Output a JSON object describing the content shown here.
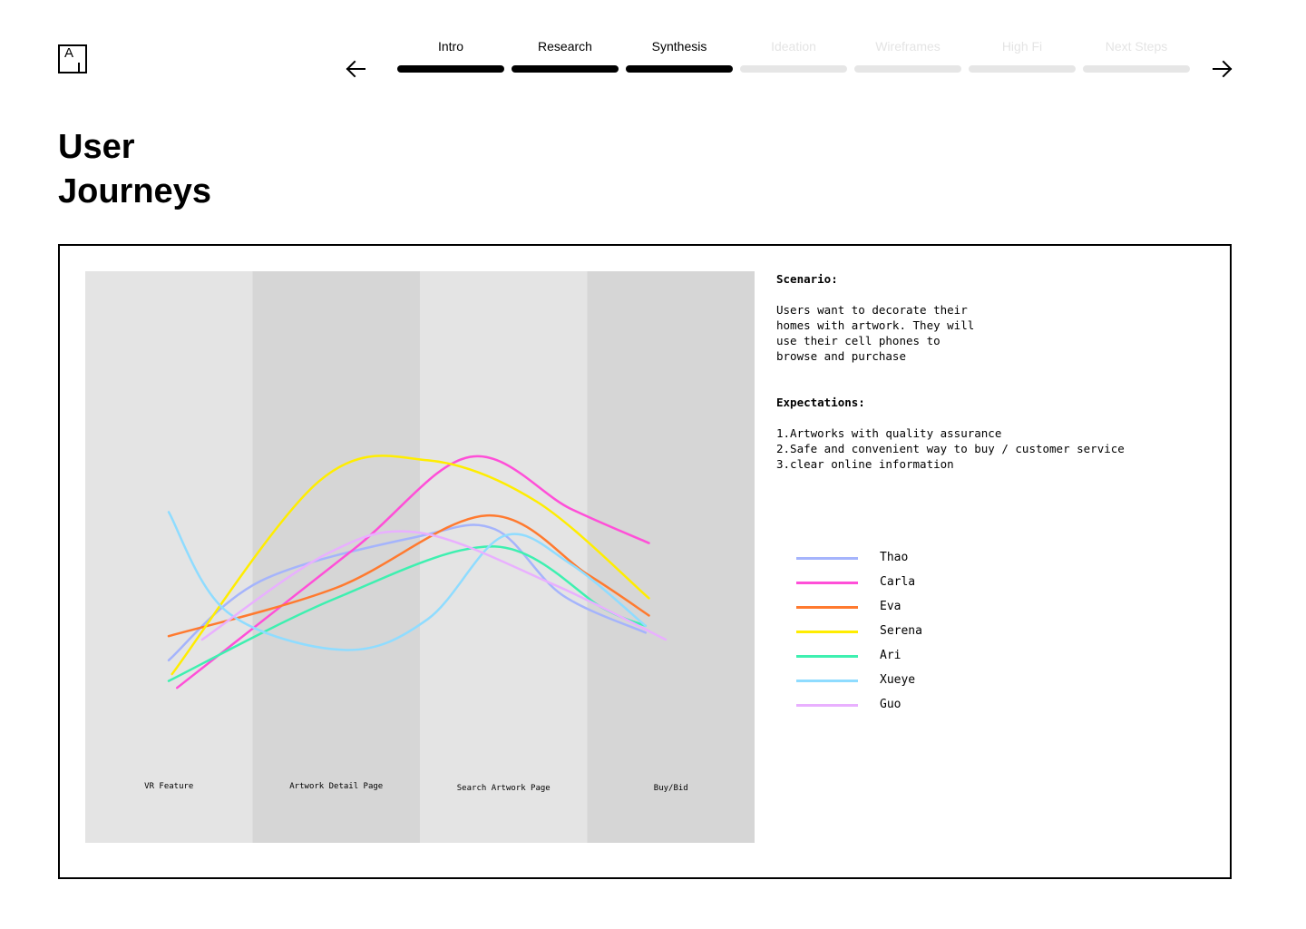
{
  "header": {
    "logo_letter": "A",
    "steps": [
      {
        "label": "Intro",
        "state": "done"
      },
      {
        "label": "Research",
        "state": "done"
      },
      {
        "label": "Synthesis",
        "state": "done"
      },
      {
        "label": "Ideation",
        "state": "todo"
      },
      {
        "label": "Wireframes",
        "state": "todo"
      },
      {
        "label": "High Fi",
        "state": "todo"
      },
      {
        "label": "Next Steps",
        "state": "todo"
      }
    ],
    "prev_icon": "arrow-left-icon",
    "next_icon": "arrow-right-icon"
  },
  "page": {
    "title_line1": "User",
    "title_line2": "Journeys"
  },
  "info": {
    "scenario_heading": "Scenario:",
    "scenario_text": "Users want to decorate their\nhomes with artwork. They will\nuse their cell phones to\nbrowse and purchase",
    "expectations_heading": "Expectations:",
    "expectations": [
      "1.Artworks with quality assurance",
      "2.Safe and convenient way to buy / customer service",
      "3.clear online information"
    ]
  },
  "chart_data": {
    "type": "line",
    "categories": [
      "VR Feature",
      "Artwork Detail Page",
      "Search Artwork Page",
      "Buy/Bid"
    ],
    "band_colors": [
      "#e4e4e4",
      "#d6d6d6",
      "#e4e4e4",
      "#d6d6d6"
    ],
    "y_range": [
      0,
      10
    ],
    "series": [
      {
        "name": "Thao",
        "color": "#a5b4fc",
        "points": [
          [
            0.0,
            2.4
          ],
          [
            0.55,
            4.7
          ],
          [
            1.5,
            6.0
          ],
          [
            1.95,
            6.2
          ],
          [
            2.35,
            4.3
          ],
          [
            2.85,
            3.2
          ]
        ]
      },
      {
        "name": "Carla",
        "color": "#ff4fd8",
        "points": [
          [
            0.05,
            1.6
          ],
          [
            1.1,
            5.6
          ],
          [
            1.8,
            8.3
          ],
          [
            2.4,
            6.8
          ],
          [
            2.87,
            5.8
          ]
        ]
      },
      {
        "name": "Eva",
        "color": "#ff7a2f",
        "points": [
          [
            0.0,
            3.1
          ],
          [
            1.0,
            4.5
          ],
          [
            1.9,
            6.6
          ],
          [
            2.5,
            4.9
          ],
          [
            2.87,
            3.7
          ]
        ]
      },
      {
        "name": "Serena",
        "color": "#ffed00",
        "points": [
          [
            0.02,
            2.0
          ],
          [
            0.9,
            7.6
          ],
          [
            1.55,
            8.2
          ],
          [
            2.2,
            7.0
          ],
          [
            2.87,
            4.2
          ]
        ]
      },
      {
        "name": "Ari",
        "color": "#3ef0b0",
        "points": [
          [
            0.0,
            1.8
          ],
          [
            1.0,
            4.2
          ],
          [
            1.95,
            5.7
          ],
          [
            2.6,
            3.9
          ],
          [
            2.85,
            3.4
          ]
        ]
      },
      {
        "name": "Xueye",
        "color": "#8fdcff",
        "points": [
          [
            0.0,
            6.7
          ],
          [
            0.35,
            3.8
          ],
          [
            1.05,
            2.7
          ],
          [
            1.55,
            3.6
          ],
          [
            2.0,
            6.0
          ],
          [
            2.4,
            5.2
          ],
          [
            2.85,
            3.4
          ]
        ]
      },
      {
        "name": "Guo",
        "color": "#e9b0ff",
        "points": [
          [
            0.2,
            3.0
          ],
          [
            0.95,
            5.5
          ],
          [
            1.5,
            6.1
          ],
          [
            2.3,
            4.6
          ],
          [
            2.97,
            3.0
          ]
        ]
      }
    ]
  }
}
